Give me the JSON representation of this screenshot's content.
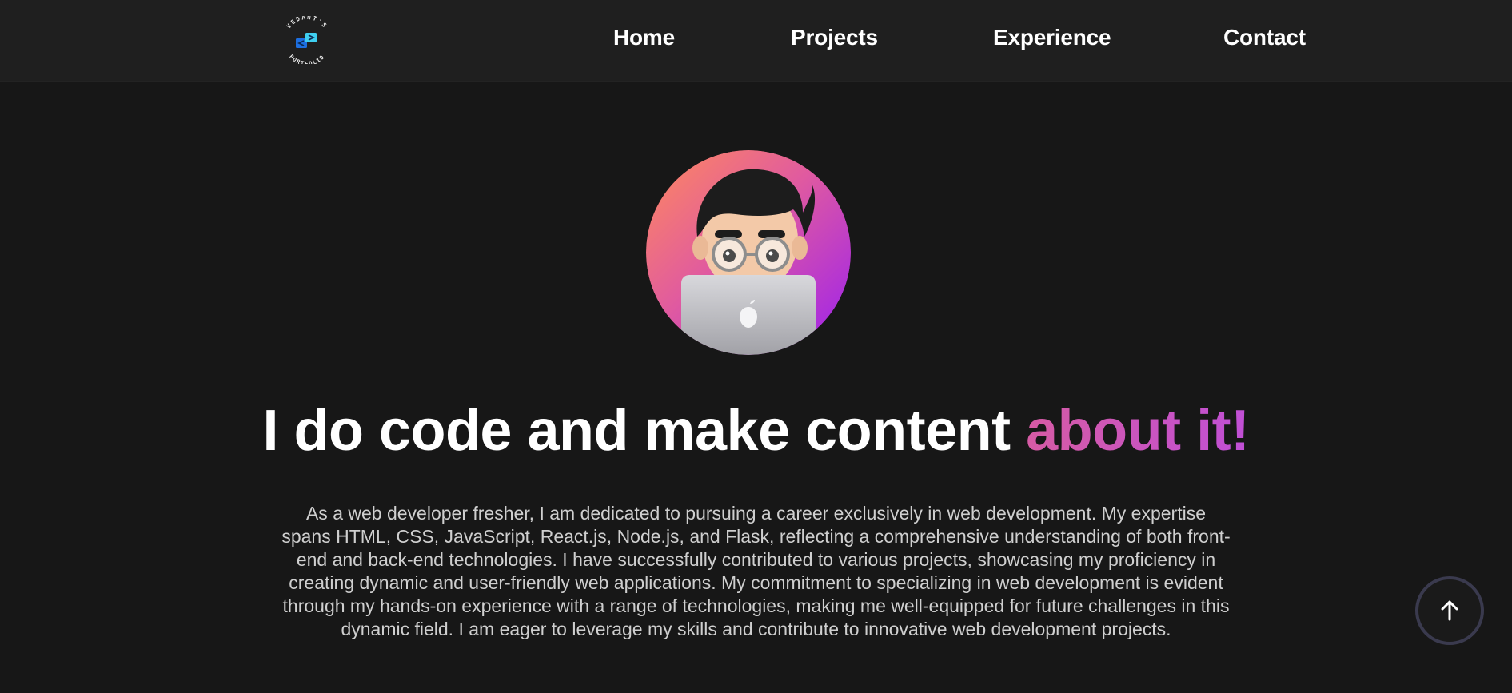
{
  "nav": {
    "logo": {
      "top_text": "VEDANT'S",
      "bottom_text": "PORTFOLIO",
      "icon": "code-arrows-icon"
    },
    "links": [
      {
        "label": "Home"
      },
      {
        "label": "Projects"
      },
      {
        "label": "Experience"
      },
      {
        "label": "Contact"
      }
    ]
  },
  "hero": {
    "avatar_icon": "memoji-laptop-avatar",
    "headline_main": "I do code and make content ",
    "headline_accent": "about it!",
    "bio": "As a web developer fresher, I am dedicated to pursuing a career exclusively in web development. My expertise spans HTML, CSS, JavaScript, React.js, Node.js, and Flask, reflecting a comprehensive understanding of both front-end and back-end technologies. I have successfully contributed to various projects, showcasing my proficiency in creating dynamic and user-friendly web applications. My commitment to specializing in web development is evident through my hands-on experience with a range of technologies, making me well-equipped for future challenges in this dynamic field. I am eager to leverage my skills and contribute to innovative web development projects."
  },
  "scroll_top": {
    "icon": "arrow-up-icon"
  },
  "colors": {
    "background": "#171717",
    "navbar": "#1f1f1f",
    "accent_start": "#d65ba4",
    "accent_end": "#c04fd6",
    "avatar_gradient_start": "#f77b6b",
    "avatar_gradient_end": "#a020f0"
  }
}
